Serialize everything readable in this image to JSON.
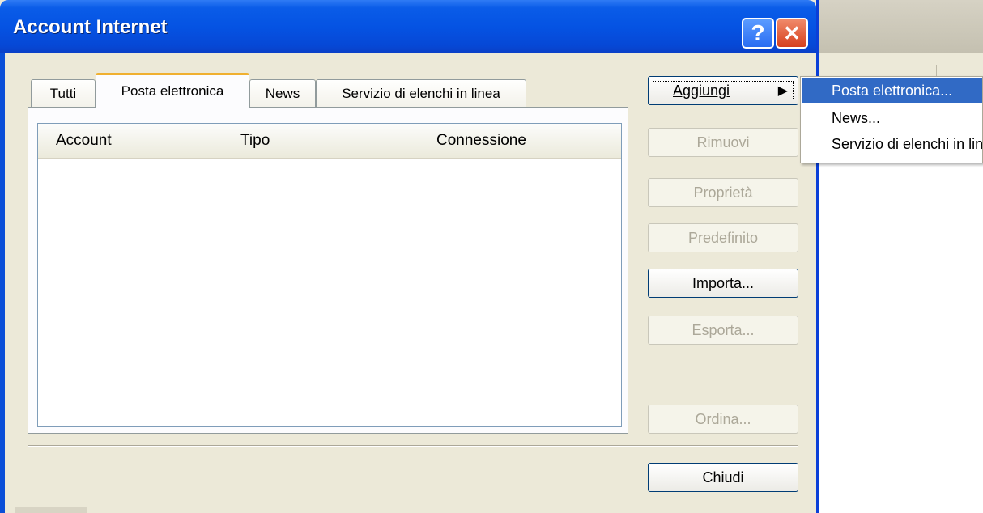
{
  "window": {
    "title": "Account Internet",
    "help_symbol": "?",
    "close_symbol": "✕"
  },
  "tabs": [
    {
      "label": "Tutti",
      "active": false
    },
    {
      "label": "Posta elettronica",
      "active": true
    },
    {
      "label": "News",
      "active": false
    },
    {
      "label": "Servizio di elenchi in linea",
      "active": false
    }
  ],
  "list": {
    "columns": [
      "Account",
      "Tipo",
      "Connessione"
    ],
    "rows": []
  },
  "buttons": {
    "aggiungi": "Aggiungi",
    "rimuovi": "Rimuovi",
    "proprieta": "Proprietà",
    "predefinito": "Predefinito",
    "importa": "Importa...",
    "esporta": "Esporta...",
    "ordina": "Ordina...",
    "chiudi": "Chiudi"
  },
  "submenu": {
    "items": [
      "Posta elettronica...",
      "News...",
      "Servizio di elenchi in linea..."
    ]
  },
  "colors": {
    "titlebar": "#0553e3",
    "menu_highlight": "#316ac5",
    "active_tab_accent": "#f0b030"
  }
}
